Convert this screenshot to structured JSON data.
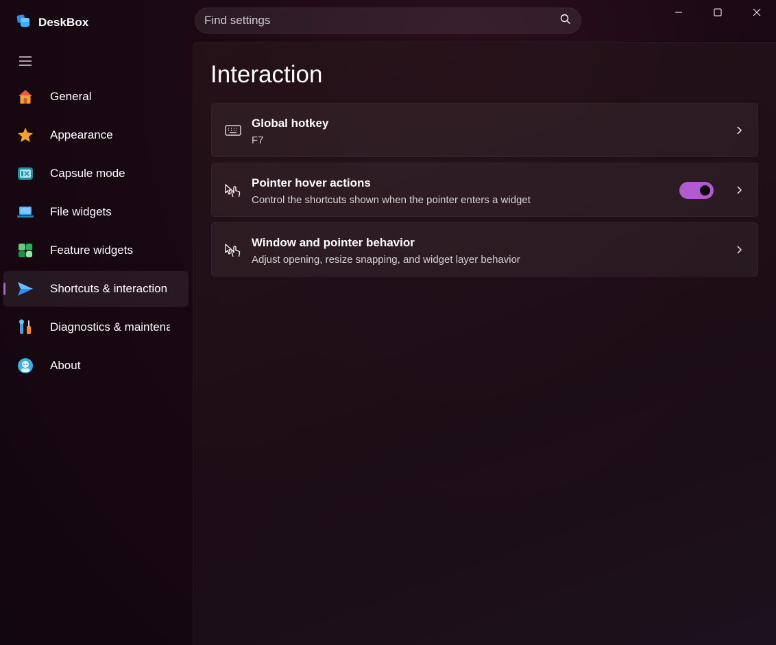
{
  "app": {
    "title": "DeskBox"
  },
  "search": {
    "placeholder": "Find settings"
  },
  "sidebar": {
    "items": [
      {
        "label": "General",
        "icon": "home-icon"
      },
      {
        "label": "Appearance",
        "icon": "star-icon"
      },
      {
        "label": "Capsule mode",
        "icon": "capsule-icon"
      },
      {
        "label": "File widgets",
        "icon": "laptop-icon"
      },
      {
        "label": "Feature widgets",
        "icon": "widgets-icon"
      },
      {
        "label": "Shortcuts & interaction",
        "icon": "send-icon",
        "selected": true
      },
      {
        "label": "Diagnostics & maintenance",
        "icon": "tools-icon"
      },
      {
        "label": "About",
        "icon": "info-bot-icon"
      }
    ]
  },
  "page": {
    "title": "Interaction",
    "cards": [
      {
        "title": "Global hotkey",
        "description": "F7",
        "icon": "keyboard-icon"
      },
      {
        "title": "Pointer hover actions",
        "description": "Control the shortcuts shown when the pointer enters a widget",
        "icon": "pointer-hand-icon",
        "toggle_on": true
      },
      {
        "title": "Window and pointer behavior",
        "description": "Adjust opening, resize snapping, and widget layer behavior",
        "icon": "pointer-hand-icon"
      }
    ]
  },
  "colors": {
    "accent": "#b35ad3",
    "background": "#1a0812"
  }
}
